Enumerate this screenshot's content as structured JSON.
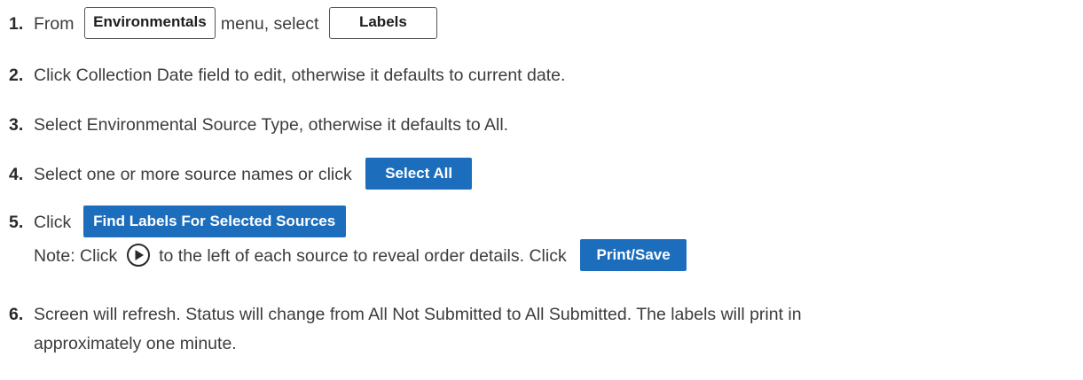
{
  "steps": [
    {
      "num": "1.",
      "text_a": "From",
      "button_a": "Environmentals",
      "text_b": "menu, select",
      "button_b": "Labels"
    },
    {
      "num": "2.",
      "text": "Click Collection Date field to edit, otherwise it defaults to current date."
    },
    {
      "num": "3.",
      "text": "Select Environmental Source Type, otherwise it defaults to All."
    },
    {
      "num": "4.",
      "text": "Select one or more source names or click",
      "button": "Select All"
    },
    {
      "num": "5.",
      "text": "Click",
      "button": "Find Labels For Selected Sources",
      "note_a": "Note: Click",
      "note_icon": "play-circle-icon",
      "note_b": "to the left of each source to reveal order details.  Click",
      "note_button": "Print/Save"
    },
    {
      "num": "6.",
      "line1": "Screen will refresh.  Status will change from All Not Submitted to All Submitted.  The labels will print in",
      "line2": "approximately one minute."
    }
  ],
  "colors": {
    "button_blue": "#1c6ebd",
    "text": "#3c3c3c"
  }
}
